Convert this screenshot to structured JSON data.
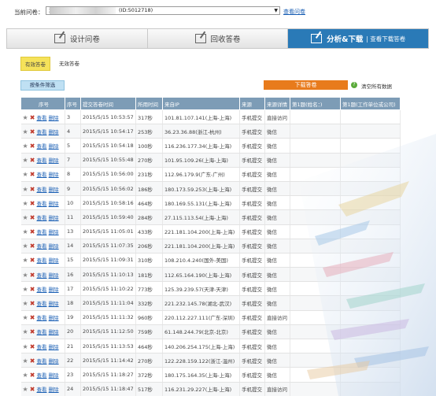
{
  "topbar": {
    "label": "当前问卷：",
    "survey_prefix": "治",
    "survey_id_text": "(ID:5012718)",
    "view_link": "查看问卷"
  },
  "tabs": [
    {
      "label": "设计问卷",
      "active": false
    },
    {
      "label": "回收答卷",
      "active": false
    },
    {
      "label": "分析&下载",
      "sub": "| 查看下载答卷",
      "active": true
    }
  ],
  "filter": {
    "valid": "有效答卷",
    "invalid": "无效答卷"
  },
  "buttons": {
    "condition": "按条件筛选",
    "download": "下载答卷",
    "help": "?",
    "clear": "清空所有数据"
  },
  "columns": [
    "序号",
    "序号",
    "提交答卷时间",
    "所用时间",
    "来自IP",
    "来源",
    "来源详情",
    "第1题(姓名：)",
    "第1题(工作单位或公司)"
  ],
  "row_actions": {
    "view": "查看",
    "delete": "删除"
  },
  "rows": [
    {
      "no": "3",
      "time": "2015/5/15 10:53:57",
      "dur": "317秒",
      "ip": "101.81.107.141(上海-上海)",
      "src": "手机提交",
      "detail": "直接访问"
    },
    {
      "no": "4",
      "time": "2015/5/15 10:54:17",
      "dur": "253秒",
      "ip": "36.23.36.88(浙江-杭州)",
      "src": "手机提交",
      "detail": "微信"
    },
    {
      "no": "5",
      "time": "2015/5/15 10:54:18",
      "dur": "100秒",
      "ip": "116.236.177.34(上海-上海)",
      "src": "手机提交",
      "detail": "微信"
    },
    {
      "no": "7",
      "time": "2015/5/15 10:55:48",
      "dur": "270秒",
      "ip": "101.95.109.26(上海-上海)",
      "src": "手机提交",
      "detail": "微信"
    },
    {
      "no": "8",
      "time": "2015/5/15 10:56:00",
      "dur": "231秒",
      "ip": "112.96.179.9(广东-广州)",
      "src": "手机提交",
      "detail": "微信"
    },
    {
      "no": "9",
      "time": "2015/5/15 10:56:02",
      "dur": "186秒",
      "ip": "180.173.59.253(上海-上海)",
      "src": "手机提交",
      "detail": "微信"
    },
    {
      "no": "10",
      "time": "2015/5/15 10:58:16",
      "dur": "464秒",
      "ip": "180.169.55.131(上海-上海)",
      "src": "手机提交",
      "detail": "微信"
    },
    {
      "no": "11",
      "time": "2015/5/15 10:59:40",
      "dur": "284秒",
      "ip": "27.115.113.54(上海-上海)",
      "src": "手机提交",
      "detail": "微信"
    },
    {
      "no": "13",
      "time": "2015/5/15 11:05:01",
      "dur": "433秒",
      "ip": "221.181.104.200(上海-上海)",
      "src": "手机提交",
      "detail": "微信"
    },
    {
      "no": "14",
      "time": "2015/5/15 11:07:35",
      "dur": "206秒",
      "ip": "221.181.104.200(上海-上海)",
      "src": "手机提交",
      "detail": "微信"
    },
    {
      "no": "15",
      "time": "2015/5/15 11:09:31",
      "dur": "310秒",
      "ip": "108.210.4.240(国外-美国)",
      "src": "手机提交",
      "detail": "微信"
    },
    {
      "no": "16",
      "time": "2015/5/15 11:10:13",
      "dur": "181秒",
      "ip": "112.65.164.190(上海-上海)",
      "src": "手机提交",
      "detail": "微信"
    },
    {
      "no": "17",
      "time": "2015/5/15 11:10:22",
      "dur": "773秒",
      "ip": "125.39.239.57(天津-天津)",
      "src": "手机提交",
      "detail": "微信"
    },
    {
      "no": "18",
      "time": "2015/5/15 11:11:04",
      "dur": "332秒",
      "ip": "221.232.145.78(湖北-武汉)",
      "src": "手机提交",
      "detail": "微信"
    },
    {
      "no": "19",
      "time": "2015/5/15 11:11:32",
      "dur": "960秒",
      "ip": "220.112.227.111(广东-深圳)",
      "src": "手机提交",
      "detail": "直接访问"
    },
    {
      "no": "20",
      "time": "2015/5/15 11:12:50",
      "dur": "759秒",
      "ip": "61.148.244.79(北京-北京)",
      "src": "手机提交",
      "detail": "微信"
    },
    {
      "no": "21",
      "time": "2015/5/15 11:13:53",
      "dur": "464秒",
      "ip": "140.206.254.175(上海-上海)",
      "src": "手机提交",
      "detail": "微信"
    },
    {
      "no": "22",
      "time": "2015/5/15 11:14:42",
      "dur": "270秒",
      "ip": "122.228.159.122(浙江-温州)",
      "src": "手机提交",
      "detail": "微信"
    },
    {
      "no": "23",
      "time": "2015/5/15 11:18:27",
      "dur": "372秒",
      "ip": "180.175.164.35(上海-上海)",
      "src": "手机提交",
      "detail": "微信"
    },
    {
      "no": "24",
      "time": "2015/5/15 11:18:47",
      "dur": "517秒",
      "ip": "116.231.29.227(上海-上海)",
      "src": "手机提交",
      "detail": "直接访问"
    }
  ]
}
